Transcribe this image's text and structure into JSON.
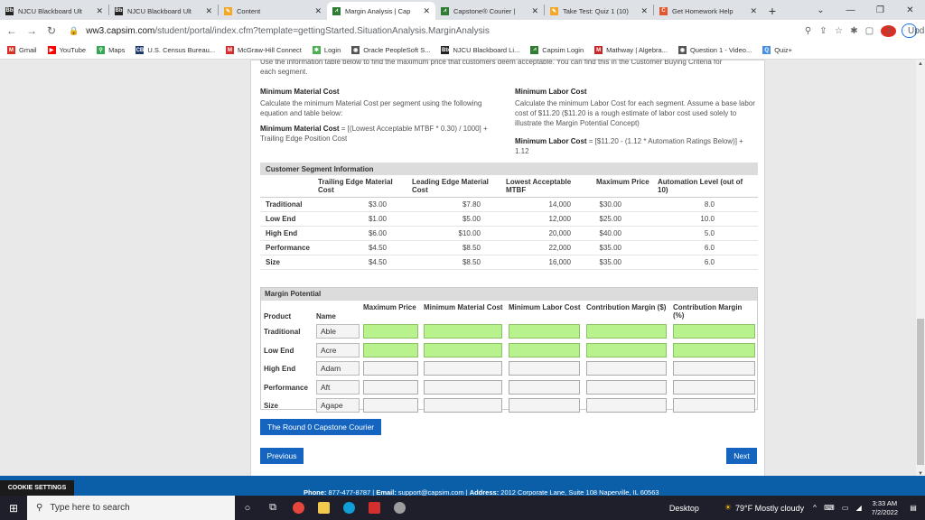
{
  "browser": {
    "tabs": [
      {
        "label": "NJCU Blackboard Ult",
        "favicon": "Bb",
        "color": "#222222"
      },
      {
        "label": "NJCU Blackboard Ult",
        "favicon": "Bb",
        "color": "#222222"
      },
      {
        "label": "Content",
        "favicon": "✎",
        "color": "#f6a623"
      },
      {
        "label": "Margin Analysis | Cap",
        "favicon": "⩘",
        "color": "#2e7d32",
        "active": true
      },
      {
        "label": "Capstone® Courier |",
        "favicon": "⩘",
        "color": "#2e7d32"
      },
      {
        "label": "Take Test: Quiz 1 (10)",
        "favicon": "✎",
        "color": "#f6a623"
      },
      {
        "label": "Get Homework Help",
        "favicon": "C",
        "color": "#e2572d"
      }
    ],
    "url_host": "ww3.capsim.com",
    "url_path": "/student/portal/index.cfm?template=gettingStarted.SituationAnalysis.MarginAnalysis",
    "update_label": "Update",
    "profile_initial": "J",
    "bookmarks": [
      {
        "label": "Gmail",
        "icon": "M",
        "color": "#d93025"
      },
      {
        "label": "YouTube",
        "icon": "▶",
        "color": "#ff0000"
      },
      {
        "label": "Maps",
        "icon": "⚲",
        "color": "#34a853"
      },
      {
        "label": "U.S. Census Bureau...",
        "icon": "CB",
        "color": "#1a3a6b"
      },
      {
        "label": "McGraw-Hill Connect",
        "icon": "M",
        "color": "#d32f2f"
      },
      {
        "label": "Login",
        "icon": "✱",
        "color": "#4caf50"
      },
      {
        "label": "Oracle PeopleSoft S...",
        "icon": "◉",
        "color": "#555555"
      },
      {
        "label": "NJCU Blackboard Li...",
        "icon": "Bb",
        "color": "#222222"
      },
      {
        "label": "Capsim Login",
        "icon": "⩘",
        "color": "#2e7d32"
      },
      {
        "label": "Mathway | Algebra...",
        "icon": "M",
        "color": "#c62828"
      },
      {
        "label": "Question 1 - Video...",
        "icon": "◉",
        "color": "#555555"
      },
      {
        "label": "Quiz+",
        "icon": "Q",
        "color": "#4a90e2"
      }
    ]
  },
  "content": {
    "intro_cut": "Use the information table below to find the maximum price that customers deem acceptable. You can find this in the Customer Buying Criteria for",
    "intro_line2": "each segment.",
    "min_material": {
      "title": "Minimum Material Cost",
      "desc": "Calculate the minimum Material Cost per segment using the following equation and table below:",
      "formula_bold": "Minimum Material Cost",
      "formula_rest": " = [(Lowest Acceptable MTBF * 0.30) / 1000] + Trailing Edge Position Cost"
    },
    "min_labor": {
      "title": "Minimum Labor Cost",
      "desc": "Calculate the minimum Labor Cost for each segment. Assume a base labor cost of $11.20 ($11.20 is a rough estimate of labor cost used solely to illustrate the Margin Potential Concept)",
      "formula_bold": "Minimum Labor Cost",
      "formula_rest": " = [$11.20 - (1.12 * Automation Ratings Below)] + 1.12"
    },
    "segment_table": {
      "title": "Customer Segment Information",
      "headers": [
        "",
        "Trailing Edge Material Cost",
        "Leading Edge Material Cost",
        "Lowest Acceptable MTBF",
        "Maximum Price",
        "Automation Level (out of 10)"
      ],
      "rows": [
        [
          "Traditional",
          "$3.00",
          "$7.80",
          "14,000",
          "$30.00",
          "8.0"
        ],
        [
          "Low End",
          "$1.00",
          "$5.00",
          "12,000",
          "$25.00",
          "10.0"
        ],
        [
          "High End",
          "$6.00",
          "$10.00",
          "20,000",
          "$40.00",
          "5.0"
        ],
        [
          "Performance",
          "$4.50",
          "$8.50",
          "22,000",
          "$35.00",
          "6.0"
        ],
        [
          "Size",
          "$4.50",
          "$8.50",
          "16,000",
          "$35.00",
          "6.0"
        ]
      ]
    },
    "margin_potential": {
      "title": "Margin Potential",
      "headers": {
        "product": "Product",
        "name": "Name",
        "max_price": "Maximum Price",
        "min_material": "Minimum Material Cost",
        "min_labor": "Minimum Labor Cost",
        "cm_dollar": "Contribution Margin ($)",
        "cm_pct": "Contribution Margin (%)"
      },
      "rows": [
        {
          "product": "Traditional",
          "name": "Able",
          "filled": true
        },
        {
          "product": "Low End",
          "name": "Acre",
          "filled": true
        },
        {
          "product": "High End",
          "name": "Adam",
          "filled": false
        },
        {
          "product": "Performance",
          "name": "Aft",
          "filled": false
        },
        {
          "product": "Size",
          "name": "Agape",
          "filled": false
        }
      ]
    },
    "courier_button": "The Round 0 Capstone Courier",
    "previous_button": "Previous",
    "next_button": "Next"
  },
  "footer": {
    "cookie_settings": "COOKIE SETTINGS",
    "phone_label": "Phone:",
    "phone": " 877-477-8787 | ",
    "email_label": "Email:",
    "email": " support@capsim.com | ",
    "address_label": "Address:",
    "address": " 2012 Corporate Lane, Suite 108 Naperville, IL 60563"
  },
  "taskbar": {
    "search_placeholder": "Type here to search",
    "desktop": "Desktop",
    "weather": "79°F  Mostly cloudy",
    "time": "3:33 AM",
    "date": "7/2/2022"
  }
}
